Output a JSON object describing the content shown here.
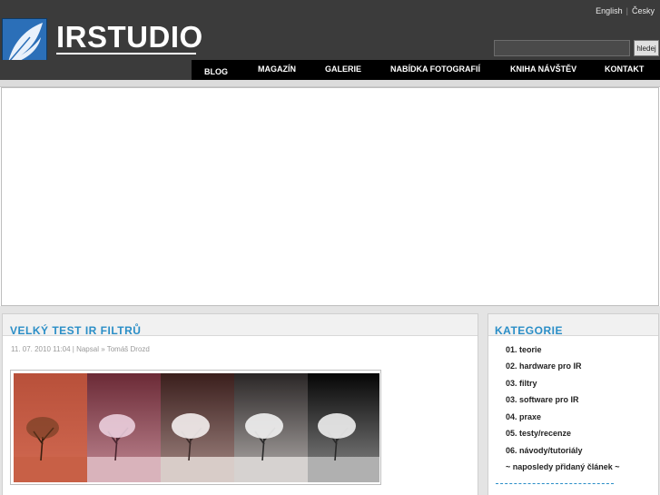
{
  "header": {
    "site_title": "IRSTUDIO",
    "lang_english": "English",
    "lang_separator": "|",
    "lang_czech": "Česky",
    "search_placeholder": "",
    "search_button": "hledej"
  },
  "nav": {
    "items": [
      {
        "label": "BLOG"
      },
      {
        "label": "MAGAZÍN"
      },
      {
        "label": "GALERIE"
      },
      {
        "label": "NABÍDKA FOTOGRAFIÍ"
      },
      {
        "label": "KNIHA NÁVŠTĚV"
      },
      {
        "label": "KONTAKT"
      }
    ]
  },
  "article": {
    "title": "VELKÝ TEST IR FILTRŮ",
    "meta": "11. 07. 2010 11:04 | Napsal » Tomáš Drozd",
    "image_icon": "infrared-tree-photo-strip"
  },
  "sidebar": {
    "title": "KATEGORIE",
    "items": [
      {
        "label": "01. teorie"
      },
      {
        "label": "02. hardware pro IR"
      },
      {
        "label": "03. filtry"
      },
      {
        "label": "03. software pro IR"
      },
      {
        "label": "04. praxe"
      },
      {
        "label": "05. testy/recenze"
      },
      {
        "label": "06. návody/tutoriály"
      },
      {
        "label": "~ naposledy přidaný článek ~"
      }
    ]
  },
  "colors": {
    "header_bg": "#3b3b3b",
    "nav_bg": "#000000",
    "accent_blue": "#2a8ec7",
    "logo_blue": "#2b6fb8"
  }
}
